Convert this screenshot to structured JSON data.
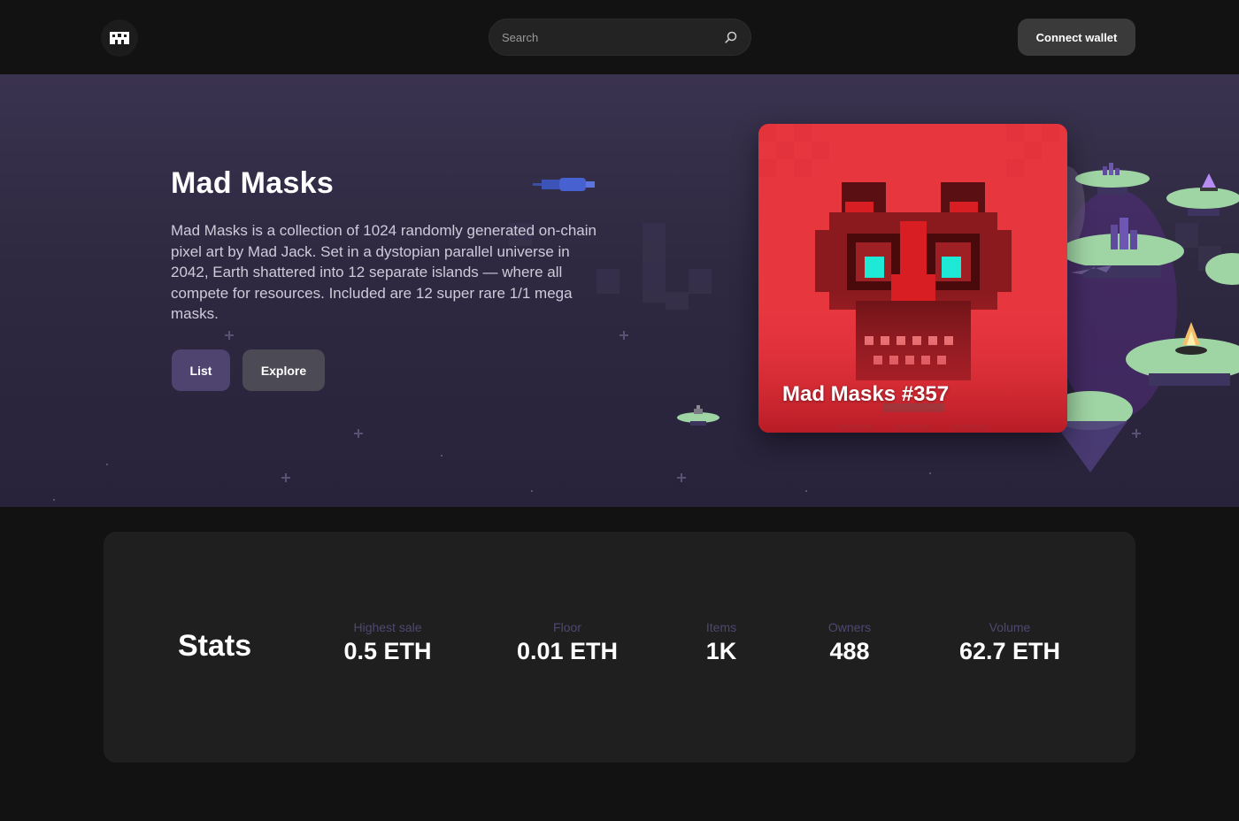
{
  "header": {
    "logo_icon": "mad-masks-logo-icon",
    "search": {
      "placeholder": "Search",
      "value": ""
    },
    "connect_wallet_label": "Connect wallet"
  },
  "hero": {
    "title": "Mad Masks",
    "description": "Mad Masks is a collection of 1024 randomly generated on-chain pixel art by Mad Jack. Set in a dystopian parallel universe in 2042, Earth shattered into 12 separate islands — where all compete for resources. Included are 12 super rare 1/1 mega masks.",
    "list_label": "List",
    "explore_label": "Explore",
    "featured_nft": {
      "name": "Mad Masks #357"
    }
  },
  "stats": {
    "title": "Stats",
    "items": [
      {
        "label": "Highest sale",
        "value": "0.5 ETH"
      },
      {
        "label": "Floor",
        "value": "0.01 ETH"
      },
      {
        "label": "Items",
        "value": "1K"
      },
      {
        "label": "Owners",
        "value": "488"
      },
      {
        "label": "Volume",
        "value": "62.7 ETH"
      }
    ]
  },
  "colors": {
    "background": "#121212",
    "hero_bg": "#2e2840",
    "accent_purple": "#4f4470",
    "nft_red": "#e8363f",
    "stat_label": "#4e4870",
    "island_green": "#9fd4a4"
  }
}
